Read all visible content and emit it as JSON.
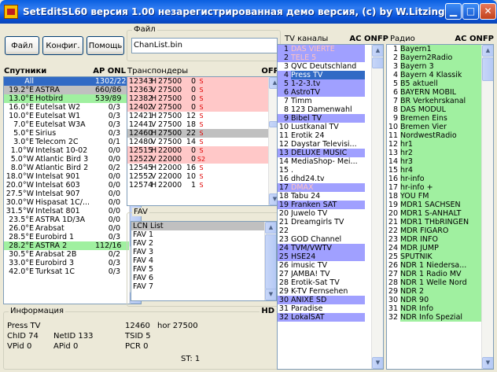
{
  "window": {
    "title": "SetEditSL60 версия  1.00  незарегистрированная демо версия, (c) by W.Litzinger..."
  },
  "toolbar": {
    "file": "Файл",
    "config": "Конфиг.",
    "help": "Помощь"
  },
  "file_group": {
    "label": "Файл",
    "value": "ChanList.bin"
  },
  "satellites": {
    "label": "Спутники",
    "flags": "AP ONL",
    "items": [
      {
        "pos": "All",
        "name": "",
        "count": "1302/222",
        "bg": "#316ac5",
        "fg": "#ffffff"
      },
      {
        "pos": "19.2°E",
        "name": "ASTRA",
        "count": "660/86",
        "bg": "#c0c0c0",
        "fg": "#000000"
      },
      {
        "pos": "13.0°E",
        "name": "Hotbird",
        "count": "539/89",
        "bg": "#a0f0a0",
        "fg": "#000000"
      },
      {
        "pos": "16.0°E",
        "name": "Eutelsat W2",
        "count": "0/3",
        "bg": "#ffffff",
        "fg": "#000000"
      },
      {
        "pos": "10.0°E",
        "name": "Eutelsat W1",
        "count": "0/3",
        "bg": "#ffffff",
        "fg": "#000000"
      },
      {
        "pos": "7.0°E",
        "name": "Eutelsat W3A",
        "count": "0/3",
        "bg": "#ffffff",
        "fg": "#000000"
      },
      {
        "pos": "5.0°E",
        "name": "Sirius",
        "count": "0/3",
        "bg": "#ffffff",
        "fg": "#000000"
      },
      {
        "pos": "3.0°E",
        "name": "Telecom 2C",
        "count": "0/1",
        "bg": "#ffffff",
        "fg": "#000000"
      },
      {
        "pos": "1.0°W",
        "name": "Intelsat 10-02",
        "count": "0/0",
        "bg": "#ffffff",
        "fg": "#000000"
      },
      {
        "pos": "5.0°W",
        "name": "Atlantic Bird 3",
        "count": "0/0",
        "bg": "#ffffff",
        "fg": "#000000"
      },
      {
        "pos": "8.0°W",
        "name": "Atlantic Bird 2",
        "count": "0/2",
        "bg": "#ffffff",
        "fg": "#000000"
      },
      {
        "pos": "18.0°W",
        "name": "Intelsat 901",
        "count": "0/0",
        "bg": "#ffffff",
        "fg": "#000000"
      },
      {
        "pos": "20.0°W",
        "name": "Intelsat 603",
        "count": "0/0",
        "bg": "#ffffff",
        "fg": "#000000"
      },
      {
        "pos": "27.5°W",
        "name": "Intelsat 907",
        "count": "0/0",
        "bg": "#ffffff",
        "fg": "#000000"
      },
      {
        "pos": "30.0°W",
        "name": "Hispasat 1C/...",
        "count": "0/0",
        "bg": "#ffffff",
        "fg": "#000000"
      },
      {
        "pos": "31.5°W",
        "name": "Intelsat 801",
        "count": "0/0",
        "bg": "#ffffff",
        "fg": "#000000"
      },
      {
        "pos": "23.5°E",
        "name": "ASTRA 1D/3A",
        "count": "0/0",
        "bg": "#ffffff",
        "fg": "#000000"
      },
      {
        "pos": "26.0°E",
        "name": "Arabsat",
        "count": "0/0",
        "bg": "#ffffff",
        "fg": "#000000"
      },
      {
        "pos": "28.5°E",
        "name": "Eurobird 1",
        "count": "0/3",
        "bg": "#ffffff",
        "fg": "#000000"
      },
      {
        "pos": "28.2°E",
        "name": "ASTRA 2",
        "count": "112/16",
        "bg": "#a0f0a0",
        "fg": "#000000"
      },
      {
        "pos": "30.5°E",
        "name": "Arabsat 2B",
        "count": "0/2",
        "bg": "#ffffff",
        "fg": "#000000"
      },
      {
        "pos": "33.0°E",
        "name": "Eurobird 3",
        "count": "0/3",
        "bg": "#ffffff",
        "fg": "#000000"
      },
      {
        "pos": "42.0°E",
        "name": "Turksat 1C",
        "count": "0/3",
        "bg": "#ffffff",
        "fg": "#000000"
      }
    ]
  },
  "transponders": {
    "label": "Транспондеры",
    "flags": "OFP",
    "items": [
      {
        "freq": "12343",
        "pol": "H",
        "sr": "27500",
        "num": "0",
        "flag": "S",
        "bg": "#ffc8c8"
      },
      {
        "freq": "12363",
        "pol": "V",
        "sr": "27500",
        "num": "0",
        "flag": "S",
        "bg": "#ffc8c8"
      },
      {
        "freq": "12382",
        "pol": "H",
        "sr": "27500",
        "num": "0",
        "flag": "S",
        "bg": "#ffc8c8"
      },
      {
        "freq": "12402",
        "pol": "V",
        "sr": "27500",
        "num": "0",
        "flag": "S",
        "bg": "#ffc8c8"
      },
      {
        "freq": "12421",
        "pol": "H",
        "sr": "27500",
        "num": "12",
        "flag": "S",
        "bg": "#ffffff"
      },
      {
        "freq": "12441",
        "pol": "V",
        "sr": "27500",
        "num": "18",
        "flag": "S",
        "bg": "#ffffff"
      },
      {
        "freq": "12460",
        "pol": "H",
        "sr": "27500",
        "num": "22",
        "flag": "S",
        "bg": "#c0c0c0"
      },
      {
        "freq": "12480",
        "pol": "V",
        "sr": "27500",
        "num": "14",
        "flag": "S",
        "bg": "#ffffff"
      },
      {
        "freq": "12515",
        "pol": "H",
        "sr": "22000",
        "num": "0",
        "flag": "S",
        "bg": "#ffc8c8"
      },
      {
        "freq": "12522",
        "pol": "V",
        "sr": "22000",
        "num": "0",
        "flag": "S2",
        "bg": "#ffc8c8"
      },
      {
        "freq": "12545",
        "pol": "H",
        "sr": "22000",
        "num": "16",
        "flag": "S",
        "bg": "#ffffff"
      },
      {
        "freq": "12552",
        "pol": "V",
        "sr": "22000",
        "num": "10",
        "flag": "S",
        "bg": "#ffffff"
      },
      {
        "freq": "12574",
        "pol": "H",
        "sr": "22000",
        "num": "1",
        "flag": "S",
        "bg": "#ffffff"
      }
    ]
  },
  "fav": {
    "label": "FAV",
    "items": [
      {
        "name": "LCN List",
        "bg": "#c0c0c0"
      },
      {
        "name": "FAV 1",
        "bg": "#ffffff"
      },
      {
        "name": "FAV 2",
        "bg": "#ffffff"
      },
      {
        "name": "FAV 3",
        "bg": "#ffffff"
      },
      {
        "name": "FAV 4",
        "bg": "#ffffff"
      },
      {
        "name": "FAV 5",
        "bg": "#ffffff"
      },
      {
        "name": "FAV 6",
        "bg": "#ffffff"
      },
      {
        "name": "FAV 7",
        "bg": "#ffffff"
      }
    ]
  },
  "info": {
    "label": "Информация",
    "flag": "HD",
    "name": "Press TV",
    "freq": "12460",
    "pol": "hor 27500",
    "chid": "ChID 74",
    "netid": "NetID 133",
    "tsid": "TSID 5",
    "vpid": "VPid 0",
    "apid": "APid 0",
    "pcr": "PCR 0",
    "st": "ST: 1"
  },
  "tv": {
    "label": "TV каналы",
    "flags": "AC ONFP",
    "items": [
      {
        "n": "1",
        "name": "DAS VIERTE",
        "bg": "#a0a0ff",
        "fg": "#ffc0c0"
      },
      {
        "n": "2",
        "name": "TELE 5",
        "bg": "#a0a0ff",
        "fg": "#ffc0c0"
      },
      {
        "n": "3",
        "name": "QVC Deutschland",
        "bg": "#ffffff",
        "fg": "#000000"
      },
      {
        "n": "4",
        "name": "Press TV",
        "bg": "#316ac5",
        "fg": "#ffffff"
      },
      {
        "n": "5",
        "name": "1-2-3.tv",
        "bg": "#a0a0ff",
        "fg": "#000000"
      },
      {
        "n": "6",
        "name": "AstroTV",
        "bg": "#a0a0ff",
        "fg": "#000000"
      },
      {
        "n": "7",
        "name": "Timm",
        "bg": "#ffffff",
        "fg": "#000000"
      },
      {
        "n": "8",
        "name": "123 Damenwahl",
        "bg": "#ffffff",
        "fg": "#000000"
      },
      {
        "n": "9",
        "name": "Bibel TV",
        "bg": "#a0a0ff",
        "fg": "#000000"
      },
      {
        "n": "10",
        "name": "Lustkanal TV",
        "bg": "#ffffff",
        "fg": "#000000"
      },
      {
        "n": "11",
        "name": "Erotik 24",
        "bg": "#ffffff",
        "fg": "#000000"
      },
      {
        "n": "12",
        "name": "Daystar Televisi...",
        "bg": "#ffffff",
        "fg": "#000000"
      },
      {
        "n": "13",
        "name": "DELUXE MUSIC",
        "bg": "#a0a0ff",
        "fg": "#000000"
      },
      {
        "n": "14",
        "name": "MediaShop- Mei...",
        "bg": "#ffffff",
        "fg": "#000000"
      },
      {
        "n": "15",
        "name": ".",
        "bg": "#ffffff",
        "fg": "#000000"
      },
      {
        "n": "16",
        "name": "dhd24.tv",
        "bg": "#ffffff",
        "fg": "#000000"
      },
      {
        "n": "17",
        "name": "DMAX",
        "bg": "#a0a0ff",
        "fg": "#ffc0c0"
      },
      {
        "n": "18",
        "name": "Tabu 24",
        "bg": "#ffffff",
        "fg": "#000000"
      },
      {
        "n": "19",
        "name": "Franken SAT",
        "bg": "#a0a0ff",
        "fg": "#000000"
      },
      {
        "n": "20",
        "name": "Juwelo TV",
        "bg": "#ffffff",
        "fg": "#000000"
      },
      {
        "n": "21",
        "name": "Dreamgirls TV",
        "bg": "#ffffff",
        "fg": "#000000"
      },
      {
        "n": "22",
        "name": "",
        "bg": "#ffffff",
        "fg": "#000000"
      },
      {
        "n": "23",
        "name": "GOD Channel",
        "bg": "#ffffff",
        "fg": "#000000"
      },
      {
        "n": "24",
        "name": "TVM/VWTV",
        "bg": "#a0a0ff",
        "fg": "#000000"
      },
      {
        "n": "25",
        "name": "HSE24",
        "bg": "#a0a0ff",
        "fg": "#000000"
      },
      {
        "n": "26",
        "name": "imusic TV",
        "bg": "#ffffff",
        "fg": "#000000"
      },
      {
        "n": "27",
        "name": "JAMBA! TV",
        "bg": "#ffffff",
        "fg": "#000000"
      },
      {
        "n": "28",
        "name": "Erotik-Sat TV",
        "bg": "#ffffff",
        "fg": "#000000"
      },
      {
        "n": "29",
        "name": "K-TV Fernsehen",
        "bg": "#ffffff",
        "fg": "#000000"
      },
      {
        "n": "30",
        "name": "ANIXE SD",
        "bg": "#a0a0ff",
        "fg": "#000000"
      },
      {
        "n": "31",
        "name": "Paradise",
        "bg": "#ffffff",
        "fg": "#000000"
      },
      {
        "n": "32",
        "name": "LokalSAT",
        "bg": "#a0a0ff",
        "fg": "#000000"
      }
    ]
  },
  "radio": {
    "label": "Радио",
    "flags": "AC ONFP",
    "items": [
      {
        "n": "1",
        "name": "Bayern1"
      },
      {
        "n": "2",
        "name": "Bayern2Radio"
      },
      {
        "n": "3",
        "name": "Bayern 3"
      },
      {
        "n": "4",
        "name": "Bayern 4 Klassik"
      },
      {
        "n": "5",
        "name": "B5 aktuell"
      },
      {
        "n": "6",
        "name": "BAYERN MOBIL"
      },
      {
        "n": "7",
        "name": "BR Verkehrskanal"
      },
      {
        "n": "8",
        "name": "DAS MODUL"
      },
      {
        "n": "9",
        "name": "Bremen Eins"
      },
      {
        "n": "10",
        "name": "Bremen Vier"
      },
      {
        "n": "11",
        "name": "NordwestRadio"
      },
      {
        "n": "12",
        "name": "hr1"
      },
      {
        "n": "13",
        "name": "hr2"
      },
      {
        "n": "14",
        "name": "hr3"
      },
      {
        "n": "15",
        "name": "hr4"
      },
      {
        "n": "16",
        "name": "hr-info"
      },
      {
        "n": "17",
        "name": "hr-info +"
      },
      {
        "n": "18",
        "name": "YOU FM"
      },
      {
        "n": "19",
        "name": "MDR1 SACHSEN"
      },
      {
        "n": "20",
        "name": "MDR1 S-ANHALT"
      },
      {
        "n": "21",
        "name": "MDR1 THbRINGEN"
      },
      {
        "n": "22",
        "name": "MDR FIGARO"
      },
      {
        "n": "23",
        "name": "MDR INFO"
      },
      {
        "n": "24",
        "name": "MDR JUMP"
      },
      {
        "n": "25",
        "name": "SPUTNIK"
      },
      {
        "n": "26",
        "name": "NDR 1 Niedersa..."
      },
      {
        "n": "27",
        "name": "NDR 1 Radio MV"
      },
      {
        "n": "28",
        "name": "NDR 1 Welle Nord"
      },
      {
        "n": "29",
        "name": "NDR 2"
      },
      {
        "n": "30",
        "name": "NDR 90"
      },
      {
        "n": "31",
        "name": "NDR Info"
      },
      {
        "n": "32",
        "name": "NDR Info Spezial"
      }
    ]
  }
}
